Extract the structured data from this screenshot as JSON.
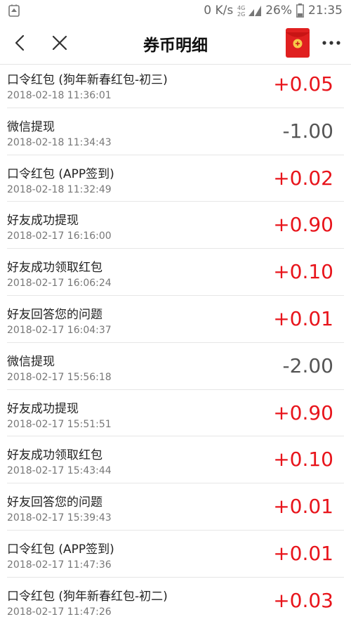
{
  "status": {
    "speed": "0 K/s",
    "network": "4G",
    "battery": "26%",
    "time": "21:35"
  },
  "header": {
    "title": "券币明细"
  },
  "colors": {
    "positive": "#e8141b",
    "negative": "#555555",
    "envelope": "#e02020"
  },
  "icons": {
    "back": "chevron-left-icon",
    "close": "close-icon",
    "envelope": "red-envelope-icon",
    "more": "more-dots-icon"
  },
  "records": [
    {
      "title": "口令红包 (狗年新春红包-初三)",
      "time": "2018-02-18 11:36:01",
      "amount": "+0.05",
      "sign": "pos"
    },
    {
      "title": "微信提现",
      "time": "2018-02-18 11:34:43",
      "amount": "-1.00",
      "sign": "neg"
    },
    {
      "title": "口令红包 (APP签到)",
      "time": "2018-02-18 11:32:49",
      "amount": "+0.02",
      "sign": "pos"
    },
    {
      "title": "好友成功提现",
      "time": "2018-02-17 16:16:00",
      "amount": "+0.90",
      "sign": "pos"
    },
    {
      "title": "好友成功领取红包",
      "time": "2018-02-17 16:06:24",
      "amount": "+0.10",
      "sign": "pos"
    },
    {
      "title": "好友回答您的问题",
      "time": "2018-02-17 16:04:37",
      "amount": "+0.01",
      "sign": "pos"
    },
    {
      "title": "微信提现",
      "time": "2018-02-17 15:56:18",
      "amount": "-2.00",
      "sign": "neg"
    },
    {
      "title": "好友成功提现",
      "time": "2018-02-17 15:51:51",
      "amount": "+0.90",
      "sign": "pos"
    },
    {
      "title": "好友成功领取红包",
      "time": "2018-02-17 15:43:44",
      "amount": "+0.10",
      "sign": "pos"
    },
    {
      "title": "好友回答您的问题",
      "time": "2018-02-17 15:39:43",
      "amount": "+0.01",
      "sign": "pos"
    },
    {
      "title": "口令红包 (APP签到)",
      "time": "2018-02-17 11:47:36",
      "amount": "+0.01",
      "sign": "pos"
    },
    {
      "title": "口令红包 (狗年新春红包-初二)",
      "time": "2018-02-17 11:47:26",
      "amount": "+0.03",
      "sign": "pos"
    }
  ]
}
